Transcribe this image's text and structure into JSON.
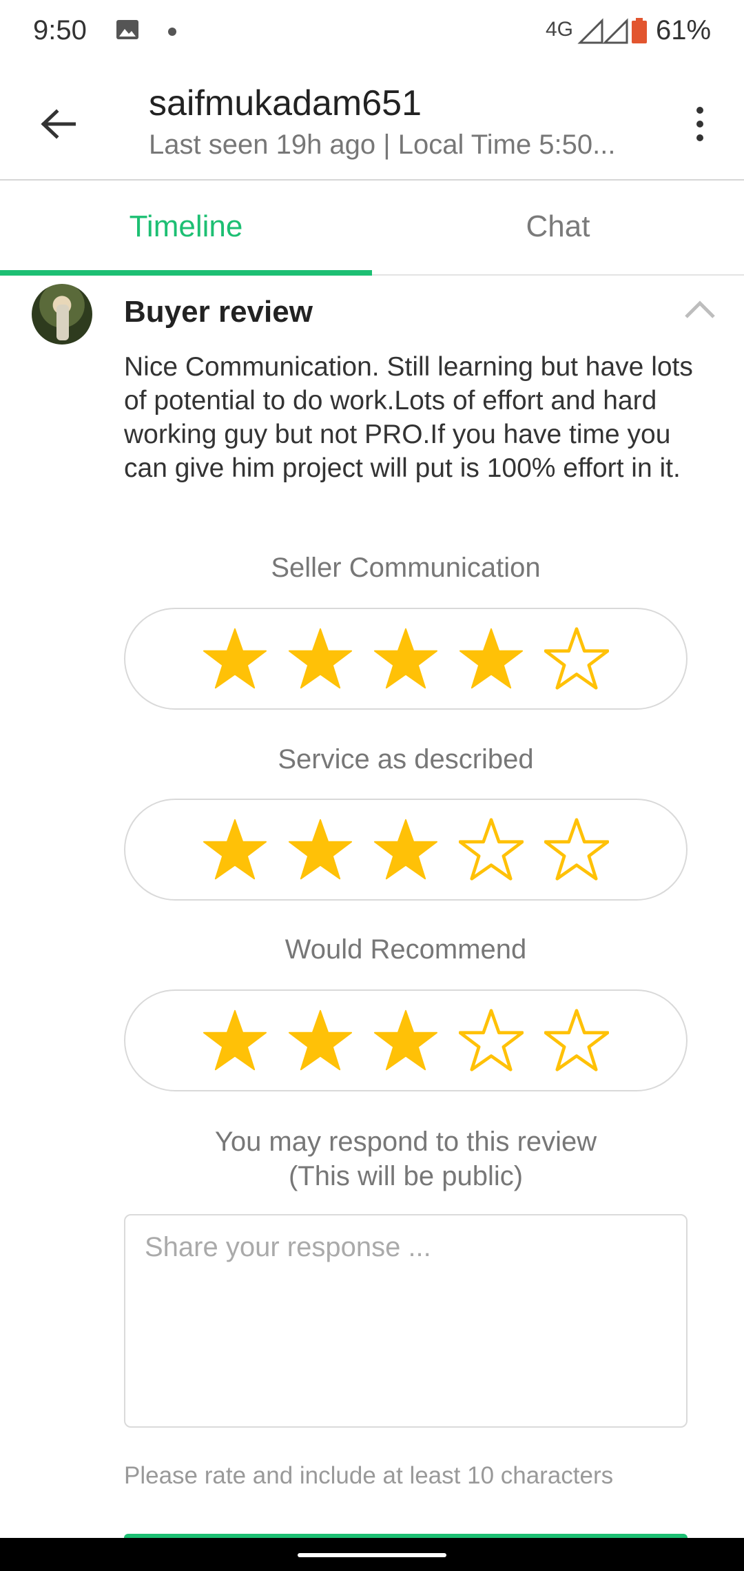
{
  "status_bar": {
    "time": "9:50",
    "network": "4G",
    "battery_percent": "61%"
  },
  "header": {
    "username": "saifmukadam651",
    "last_seen": "Last seen 19h ago | Local Time 5:50..."
  },
  "tabs": [
    {
      "label": "Timeline",
      "active": true
    },
    {
      "label": "Chat",
      "active": false
    }
  ],
  "review": {
    "title": "Buyer review",
    "text": "Nice Communication. Still learning but have lots of potential to do work.Lots of effort and hard working guy but not PRO.If you have time you can give him project will put is 100% effort in it.",
    "ratings": [
      {
        "label": "Seller Communication",
        "stars": 4,
        "max": 5
      },
      {
        "label": "Service as described",
        "stars": 3,
        "max": 5
      },
      {
        "label": "Would Recommend",
        "stars": 3,
        "max": 5
      }
    ]
  },
  "response": {
    "prompt_line1": "You may respond to this review",
    "prompt_line2": "(This will be public)",
    "placeholder": "Share your response ...",
    "hint": "Please rate and include at least 10 characters"
  },
  "colors": {
    "accent": "#1dbf73",
    "star": "#ffc107"
  }
}
